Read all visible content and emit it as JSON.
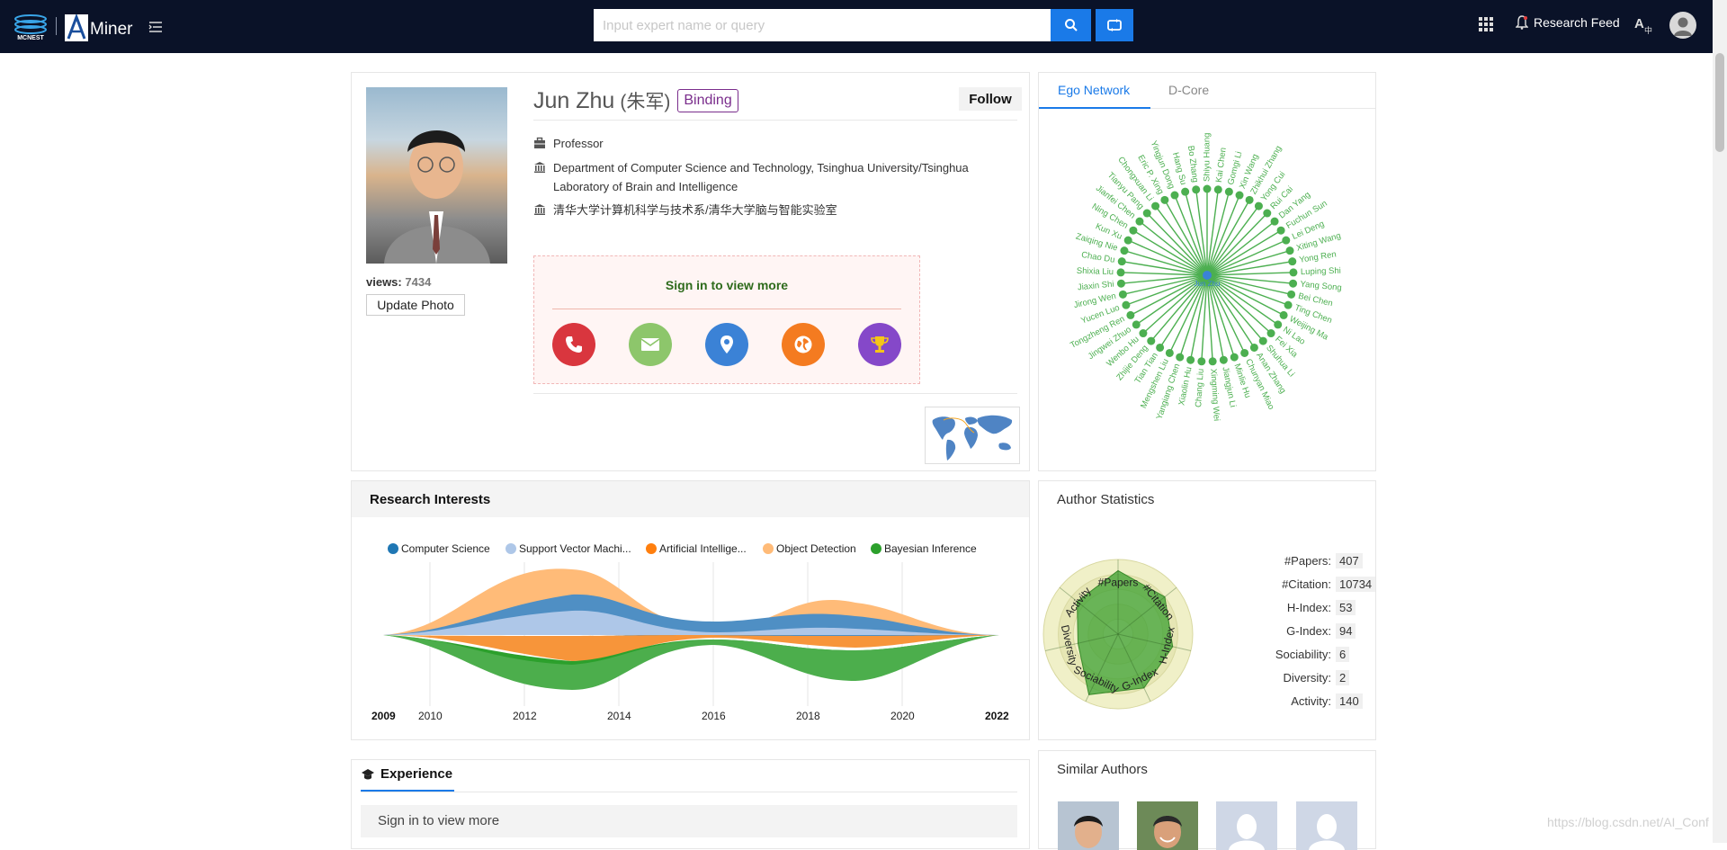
{
  "header": {
    "search_placeholder": "Input expert name or query",
    "logo_text": "Miner",
    "logo_wordmark": "MCNEST",
    "research_feed_label": "Research Feed"
  },
  "profile": {
    "name": "Jun Zhu",
    "name_cn": "(朱军)",
    "binding_label": "Binding",
    "follow_label": "Follow",
    "views_label": "views:",
    "views_count": "7434",
    "update_photo_label": "Update Photo",
    "position": "Professor",
    "affiliation_line1": "Department of Computer Science and Technology, Tsinghua University/Tsinghua",
    "affiliation_line2": "Laboratory of Brain and Intelligence",
    "affiliation_cn": "清华大学计算机科学与技术系/清华大学脑与智能实验室",
    "signin_title": "Sign in to view more",
    "contact_icons": [
      "phone-icon",
      "email-icon",
      "location-icon",
      "homepage-icon",
      "award-icon"
    ],
    "contact_colors": [
      "#d9363e",
      "#8dc66b",
      "#3b82d6",
      "#f47b20",
      "#8548c9"
    ]
  },
  "ego": {
    "tabs": [
      "Ego Network",
      "D-Core"
    ],
    "center": "Jun Zhu",
    "names": [
      "Shiyu Huang",
      "Kai Chen",
      "Gomgi Li",
      "Xin Wang",
      "Zhikhui Zhang",
      "Yong Cui",
      "Rui Cai",
      "Dan Yang",
      "Fuchun Sun",
      "Lei Deng",
      "Xiting Wang",
      "Yong Ren",
      "Luping Shi",
      "Yang Song",
      "Bei Chen",
      "Ting Chen",
      "Weijing Ma",
      "Ni Lao",
      "Fei Xia",
      "Shuhua Li",
      "Anan Zhang",
      "Chunyan Miao",
      "Minlie Hu",
      "Jiangjun Li",
      "Xingming Wei",
      "Chang Liu",
      "Xiaolin Hu",
      "Yangiang Chen",
      "Mengshen Liu",
      "Tian Tian",
      "Zhijie Deng",
      "Wenbo Hu",
      "Jingwei Zhuo",
      "Tongzheng Ren",
      "Yucen Luo",
      "Jirong Wen",
      "Jiaxin Shi",
      "Shixia Liu",
      "Chao Du",
      "Zaiqing Nie",
      "Kun Xu",
      "Ning Chen",
      "Jianfei Chen",
      "Tianyu Pang",
      "Chongxuan Li",
      "Eric P. Xing",
      "Yingjun Dong",
      "Hang Su",
      "Bo Zhang"
    ],
    "node_color": "#4caf50"
  },
  "research": {
    "title": "Research Interests",
    "legend": [
      {
        "label": "Computer Science",
        "color": "#1f77b4"
      },
      {
        "label": "Support Vector Machi...",
        "color": "#aec7e8"
      },
      {
        "label": "Artificial Intellige...",
        "color": "#ff7f0e"
      },
      {
        "label": "Object Detection",
        "color": "#ffbb78"
      },
      {
        "label": "Bayesian Inference",
        "color": "#2ca02c"
      }
    ],
    "axis_labels": [
      "2009",
      "2010",
      "2012",
      "2014",
      "2016",
      "2018",
      "2020",
      "2022"
    ]
  },
  "stats": {
    "title": "Author Statistics",
    "rows": [
      {
        "label": "#Papers:",
        "value": "407"
      },
      {
        "label": "#Citation:",
        "value": "10734"
      },
      {
        "label": "H-Index:",
        "value": "53"
      },
      {
        "label": "G-Index:",
        "value": "94"
      },
      {
        "label": "Sociability:",
        "value": "6"
      },
      {
        "label": "Diversity:",
        "value": "2"
      },
      {
        "label": "Activity:",
        "value": "140"
      }
    ],
    "radar_axes": [
      "#Papers",
      "#Citation",
      "H-Index",
      "G-Index",
      "Sociability",
      "Diversity",
      "Activity"
    ],
    "radar_levels": [
      0.85,
      0.8,
      0.75,
      0.8,
      0.9,
      0.55,
      0.7
    ]
  },
  "experience": {
    "title": "Experience",
    "signin": "Sign in to view more"
  },
  "similar": {
    "title": "Similar Authors"
  },
  "watermark": "https://blog.csdn.net/AI_Conf"
}
